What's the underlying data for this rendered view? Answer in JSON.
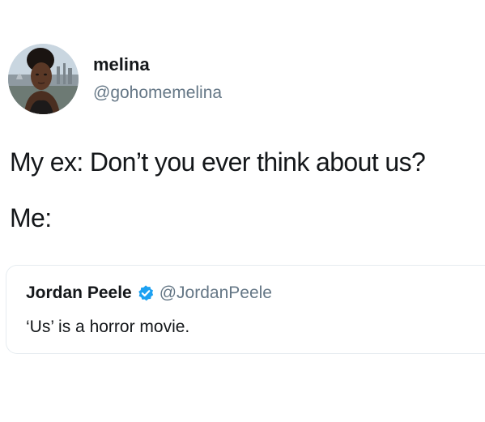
{
  "tweet": {
    "author": {
      "display_name": "melina",
      "handle": "@gohomemelina",
      "avatar_icon": "profile-photo"
    },
    "text_lines": [
      "My ex: Don’t you ever think about us?",
      "Me:"
    ],
    "quoted_tweet": {
      "display_name": "Jordan Peele",
      "verified_icon": "verified-badge-icon",
      "handle": "@JordanPeele",
      "text": "‘Us’ is a horror movie."
    }
  },
  "colors": {
    "text_primary": "#14171a",
    "text_secondary": "#657786",
    "verified_blue": "#1da1f2",
    "card_border": "#e6ecf0",
    "background": "#ffffff"
  }
}
